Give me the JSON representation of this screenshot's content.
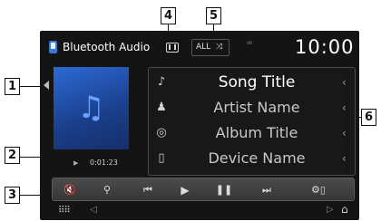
{
  "header": {
    "source_label": "Bluetooth Audio",
    "repeat_label": "ALL",
    "shuffle_glyph": "⤨",
    "signal_text": "ılıl",
    "clock": "10:00"
  },
  "left": {
    "art_note": "♫",
    "play_glyph": "▶",
    "time": "0:01:23"
  },
  "track_info": [
    {
      "icon": "♪",
      "text": "Song Title",
      "chevron": "‹"
    },
    {
      "icon": "♟",
      "text": "Artist Name",
      "chevron": "‹"
    },
    {
      "icon": "◎",
      "text": "Album Title",
      "chevron": "‹"
    },
    {
      "icon": "▯",
      "text": "Device Name",
      "chevron": "‹"
    }
  ],
  "controls": [
    {
      "name": "mute-button",
      "icon": "mute-icon",
      "glyph": "🔇"
    },
    {
      "name": "search-button",
      "icon": "search-icon",
      "glyph": "⚲"
    },
    {
      "name": "previous-button",
      "icon": "previous-icon",
      "glyph": "⏮"
    },
    {
      "name": "play-button",
      "icon": "play-icon",
      "glyph": "▶"
    },
    {
      "name": "pause-button",
      "icon": "pause-icon",
      "glyph": "❚❚"
    },
    {
      "name": "next-button",
      "icon": "next-icon",
      "glyph": "⏭"
    },
    {
      "name": "settings-button",
      "icon": "device-settings-icon",
      "glyph": "⚙▯"
    }
  ],
  "bottom_nav": {
    "grid_glyph": "⠿⠿",
    "left_glyph": "◁",
    "right_glyph": "▷",
    "home_glyph": "⌂"
  },
  "callouts": [
    "1",
    "2",
    "3",
    "4",
    "5",
    "6"
  ]
}
